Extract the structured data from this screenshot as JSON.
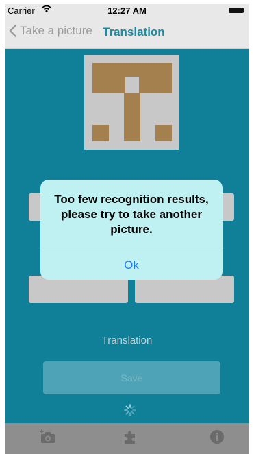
{
  "status_bar": {
    "carrier": "Carrier",
    "time": "12:27 AM"
  },
  "nav": {
    "back_label": "Take a picture",
    "title": "Translation"
  },
  "content": {
    "translation_label": "Translation",
    "save_label": "Save"
  },
  "alert": {
    "message": "Too few recognition results, please try to take another picture.",
    "ok_label": "Ok"
  },
  "tabs": [
    {
      "icon": "camera-add-icon"
    },
    {
      "icon": "puzzle-icon"
    },
    {
      "icon": "info-icon"
    }
  ],
  "colors": {
    "teal": "#107f98",
    "nav_title": "#1a8ba3",
    "glyph_brown": "#a5804f",
    "alert_background": "#bff1f2",
    "link_blue": "#1a7ff0",
    "tab_bar": "#8e8e8e"
  }
}
